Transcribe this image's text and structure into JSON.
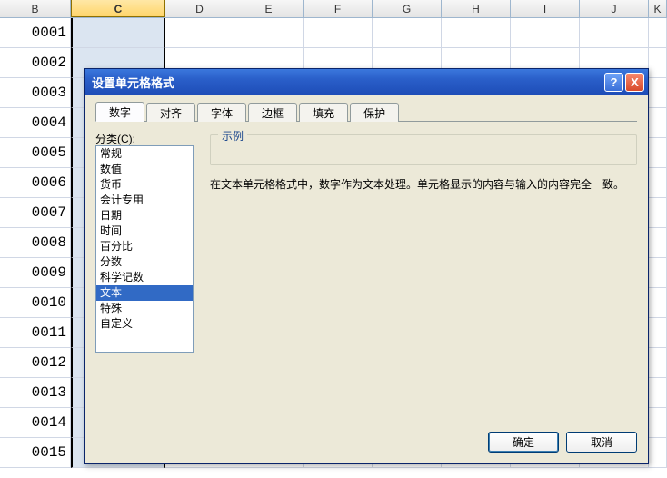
{
  "columns": [
    "B",
    "C",
    "D",
    "E",
    "F",
    "G",
    "H",
    "I",
    "J",
    "K"
  ],
  "selected_column": "C",
  "rows": [
    "0001",
    "0002",
    "0003",
    "0004",
    "0005",
    "0006",
    "0007",
    "0008",
    "0009",
    "0010",
    "0011",
    "0012",
    "0013",
    "0014",
    "0015"
  ],
  "dialog": {
    "title": "设置单元格格式",
    "help_symbol": "?",
    "close_symbol": "X",
    "tabs": [
      "数字",
      "对齐",
      "字体",
      "边框",
      "填充",
      "保护"
    ],
    "active_tab": 0,
    "category_label": "分类(C):",
    "categories": [
      "常规",
      "数值",
      "货币",
      "会计专用",
      "日期",
      "时间",
      "百分比",
      "分数",
      "科学记数",
      "文本",
      "特殊",
      "自定义"
    ],
    "selected_category": 9,
    "example_label": "示例",
    "description": "在文本单元格格式中，数字作为文本处理。单元格显示的内容与输入的内容完全一致。",
    "ok_label": "确定",
    "cancel_label": "取消"
  }
}
